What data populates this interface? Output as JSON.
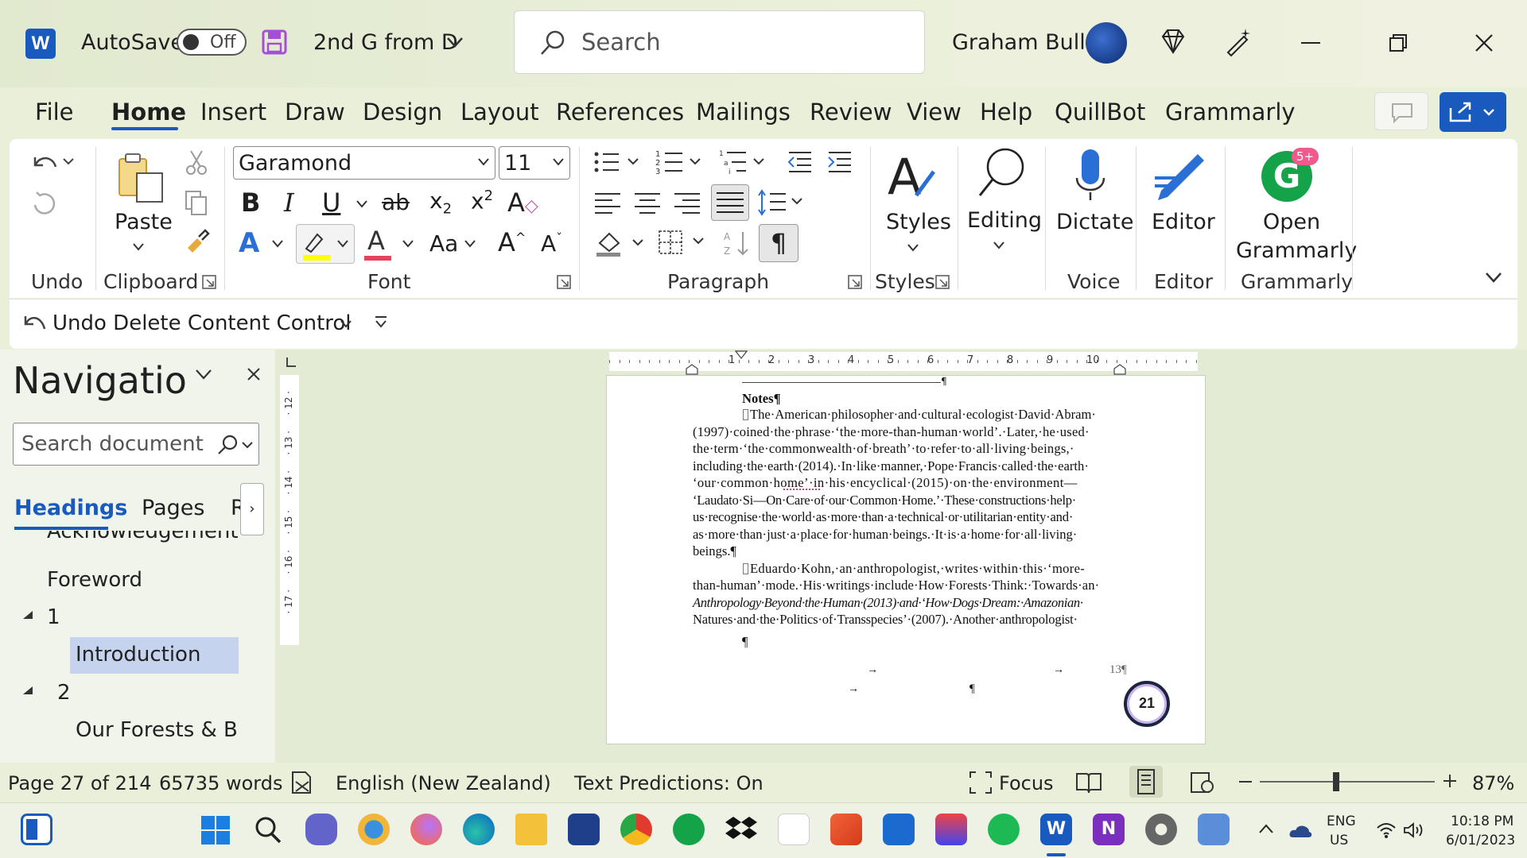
{
  "window": {
    "autosave_label": "AutoSave",
    "autosave_state": "Off",
    "doc_title": "2nd G from D",
    "search_placeholder": "Search",
    "user_name": "Graham Bull"
  },
  "tabs": [
    "File",
    "Home",
    "Insert",
    "Draw",
    "Design",
    "Layout",
    "References",
    "Mailings",
    "Review",
    "View",
    "Help",
    "QuillBot",
    "Grammarly"
  ],
  "ribbon": {
    "undo_group": "Undo",
    "clipboard": {
      "paste": "Paste",
      "group": "Clipboard"
    },
    "font": {
      "name": "Garamond",
      "size": "11",
      "group": "Font"
    },
    "paragraph": {
      "group": "Paragraph"
    },
    "styles": {
      "label": "Styles",
      "group": "Styles"
    },
    "editing": {
      "label": "Editing"
    },
    "voice": {
      "label": "Dictate",
      "group": "Voice"
    },
    "editor": {
      "label": "Editor",
      "group": "Editor"
    },
    "grammarly": {
      "label1": "Open",
      "label2": "Grammarly",
      "group": "Grammarly",
      "badge": "5+"
    }
  },
  "qat": {
    "undo_label": "Undo Delete Content Control"
  },
  "nav": {
    "title": "Navigatior.",
    "search_placeholder": "Search document",
    "tabs": [
      "Headings",
      "Pages",
      "R"
    ],
    "items": [
      "Acknowledgements",
      "Foreword",
      "1",
      "Introduction",
      "2",
      "Our Forests & B..."
    ]
  },
  "ruler": {
    "h_ticks": [
      "1",
      "2",
      "3",
      "4",
      "5",
      "6",
      "7",
      "8",
      "9",
      "10"
    ],
    "v_ticks": [
      "12",
      "13",
      "14",
      "15",
      "16",
      "17"
    ]
  },
  "document": {
    "heading": "Notes¶",
    "lines": [
      "The·American·philosopher·and·cultural·ecologist·David·Abram·",
      "(1997)·coined·the·phrase·‘the·more-than-human·world’.·Later,·he·used·",
      "the·term·‘the·commonwealth·of·breath’·to·refer·to·all·living·beings,·",
      "including·the·earth·(2014).·In·like·manner,·Pope·Francis·called·the·earth·",
      "‘our·common·home’·in·his·encyclical·(2015)·on·the·environment—",
      "‘Laudato·Si—On·Care·of·our·Common·Home.’·These·constructions·help·",
      "us·recognise·the·world·as·more·than·a·technical·or·utilitarian·entity·and·",
      "as·more·than·just·a·place·for·human·beings.·It·is·a·home·for·all·living·",
      "beings.¶",
      "Eduardo·Kohn,·an·anthropologist,·writes·within·this·‘more-",
      "than-human’·mode.·His·writings·include·How·Forests·Think:·Towards·an·",
      "Anthropology·Beyond·the·Human·(2013)·and·‘How·Dogs·Dream:·Amazonian·",
      "Natures·and·the·Politics·of·Transspecies’·(2007).·Another·anthropologist·"
    ],
    "para_mark": "¶",
    "footer_page": "13¶",
    "badge": "21"
  },
  "status": {
    "page": "Page 27 of 214",
    "words": "65735 words",
    "language": "English (New Zealand)",
    "predictions": "Text Predictions: On",
    "focus": "Focus",
    "zoom": "87%"
  },
  "tray": {
    "lang1": "ENG",
    "lang2": "US",
    "time": "10:18 PM",
    "date": "6/01/2023"
  }
}
